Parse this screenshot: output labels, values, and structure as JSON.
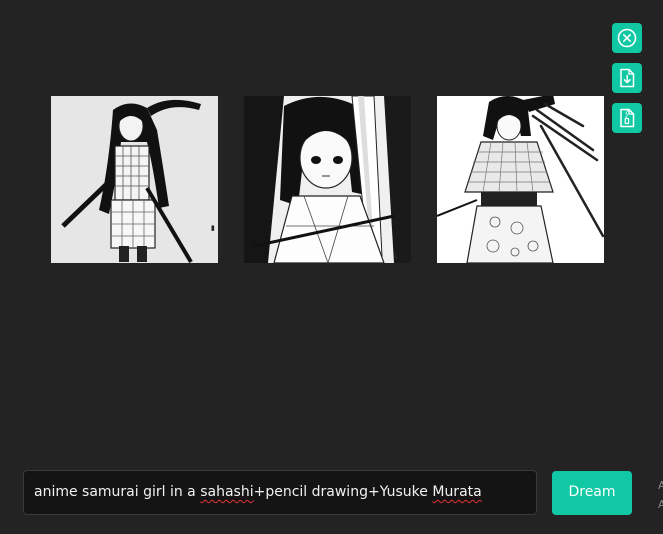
{
  "actions": [
    {
      "name": "close",
      "icon": "close-circle-icon"
    },
    {
      "name": "download",
      "icon": "file-download-icon"
    },
    {
      "name": "archive",
      "icon": "file-zip-icon"
    }
  ],
  "gallery": [
    {
      "subject": "standing samurai girl with long hair and plaid kimono"
    },
    {
      "subject": "samurai girl close-up with sword"
    },
    {
      "subject": "samurai girl in patterned kimono holding swords"
    }
  ],
  "prompt": {
    "before": "anime samurai girl in a ",
    "misspelled_1": "sahashi",
    "middle": "+pencil drawing+Yusuke ",
    "misspelled_2": "Murata"
  },
  "dream_button": {
    "label": "Dream"
  },
  "edge_text": [
    "A",
    "A"
  ],
  "colors": {
    "background": "#232323",
    "accent": "#10c8a4",
    "input_bg": "#141414",
    "spellcheck": "#e0313a"
  }
}
